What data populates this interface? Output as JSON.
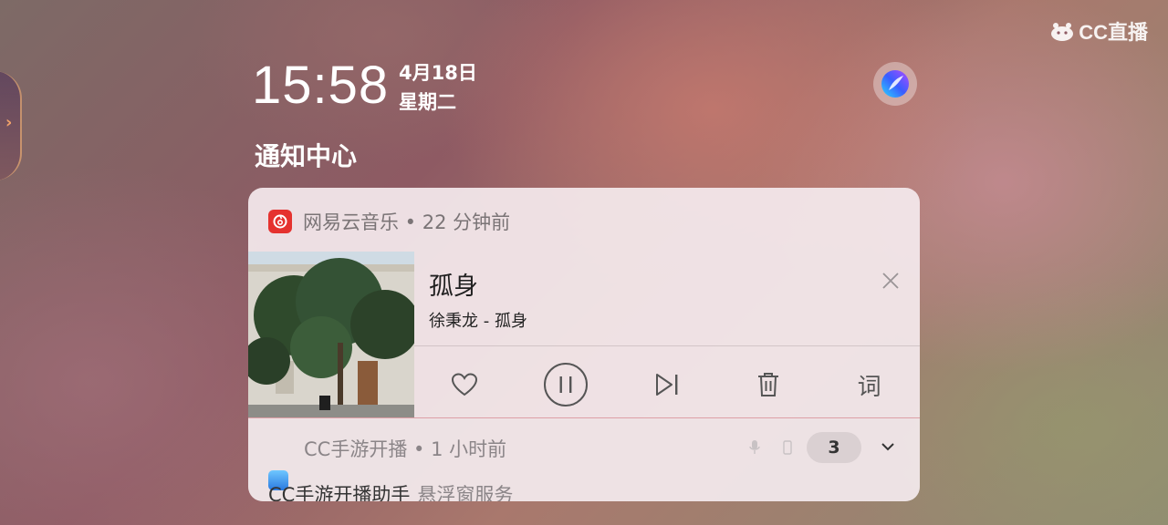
{
  "brand": {
    "label": "CC直播"
  },
  "lockscreen": {
    "time": "15:58",
    "date": "4月18日",
    "weekday": "星期二",
    "section_title": "通知中心"
  },
  "music_notification": {
    "app_name": "网易云音乐",
    "separator": " • ",
    "time_ago": "22 分钟前",
    "song_title": "孤身",
    "song_artist": "徐秉龙 - 孤身",
    "lyrics_label": "词",
    "icons": [
      "heart-icon",
      "pause-icon",
      "skip-next-icon",
      "trash-icon",
      "close-icon"
    ],
    "accent_color": "#e5322f"
  },
  "cc_notification": {
    "app_name": "CC手游开播",
    "separator": " • ",
    "time_ago": "1 小时前",
    "count": "3",
    "body_title": "CC手游开播助手",
    "body_subtitle": "悬浮窗服务"
  }
}
